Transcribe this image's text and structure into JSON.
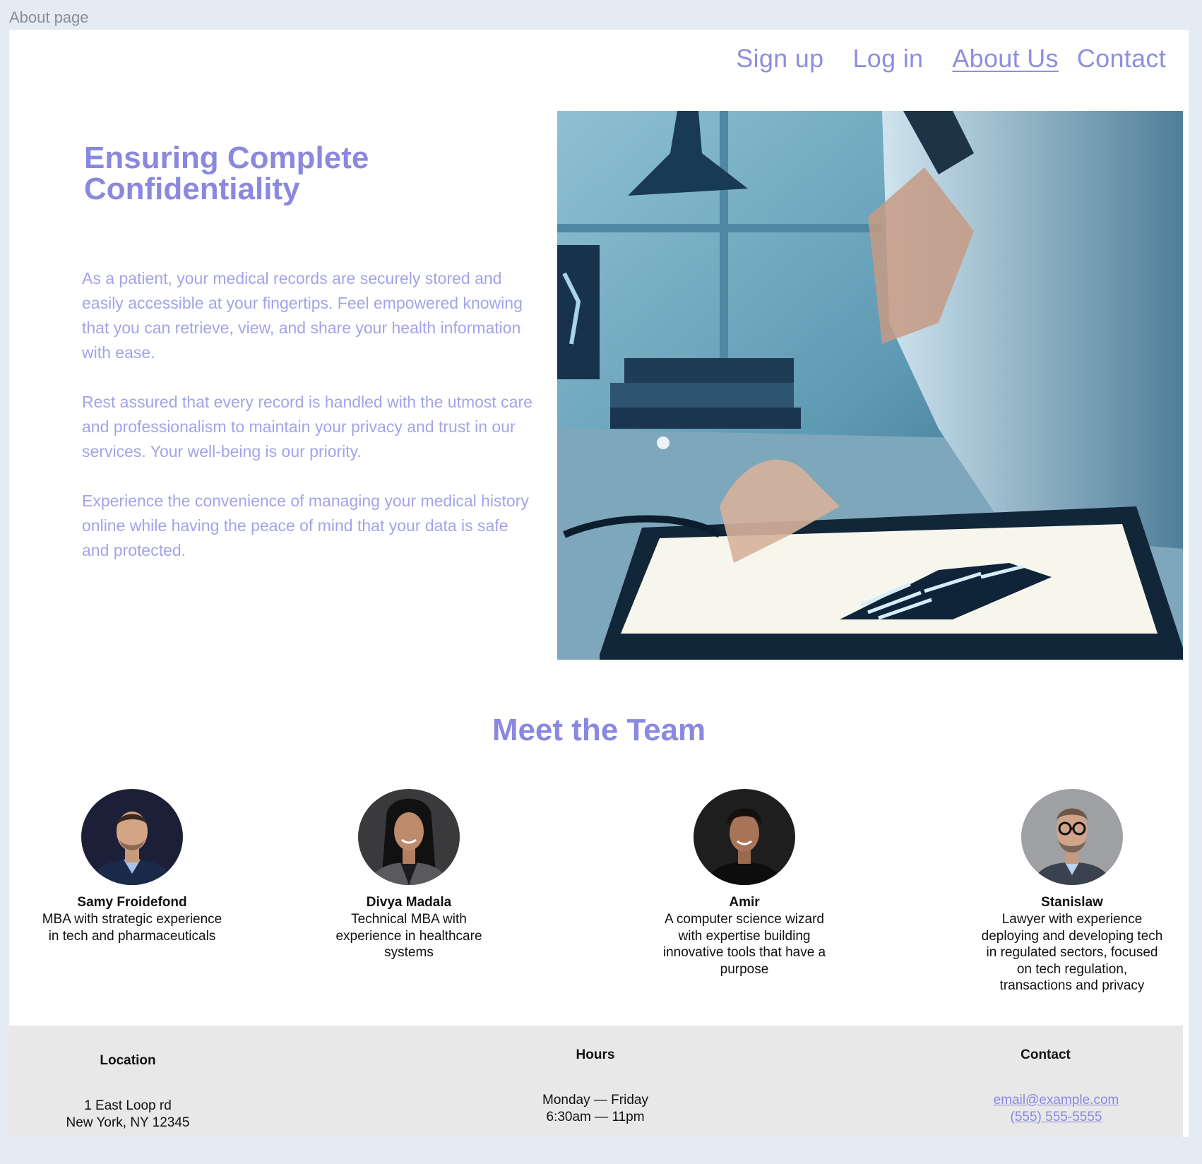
{
  "frame_label": "About page",
  "nav": {
    "signup": "Sign up",
    "login": "Log in",
    "about": "About Us",
    "contact": "Contact"
  },
  "hero": {
    "title": "Ensuring Complete Confidentiality",
    "paragraphs": [
      "As a patient, your medical records are securely stored and easily accessible at your fingertips. Feel empowered knowing that you can retrieve, view, and share your health information with ease.",
      "Rest assured that every record is handled with the utmost care and professionalism to maintain your privacy and trust in our services. Your well-being is our priority.",
      "Experience the convenience of managing your medical history online while having the peace of mind that your data is safe and protected."
    ]
  },
  "team": {
    "title": "Meet the Team",
    "members": [
      {
        "name": "Samy Froidefond",
        "bio": "MBA with strategic experience in tech and pharmaceuticals"
      },
      {
        "name": "Divya Madala",
        "bio": "Technical MBA  with experience in healthcare systems"
      },
      {
        "name": "Amir",
        "bio": "A computer science wizard with expertise building innovative tools that have a purpose"
      },
      {
        "name": "Stanislaw",
        "bio": "Lawyer with experience deploying and developing tech in regulated sectors, focused on tech regulation, transactions and privacy"
      }
    ]
  },
  "footer": {
    "location": {
      "heading": "Location",
      "line1": "1 East Loop rd",
      "line2": "New York, NY 12345"
    },
    "hours": {
      "heading": "Hours",
      "line1": "Monday — Friday",
      "line2": "6:30am — 11pm"
    },
    "contact": {
      "heading": "Contact",
      "email": "email@example.com",
      "phone": "(555) 555-5555"
    }
  },
  "colors": {
    "accent": "#8a88df",
    "body_text": "#a3a3ea",
    "footer_bg": "#e8e8e9",
    "canvas_bg": "#e4ebf3"
  }
}
